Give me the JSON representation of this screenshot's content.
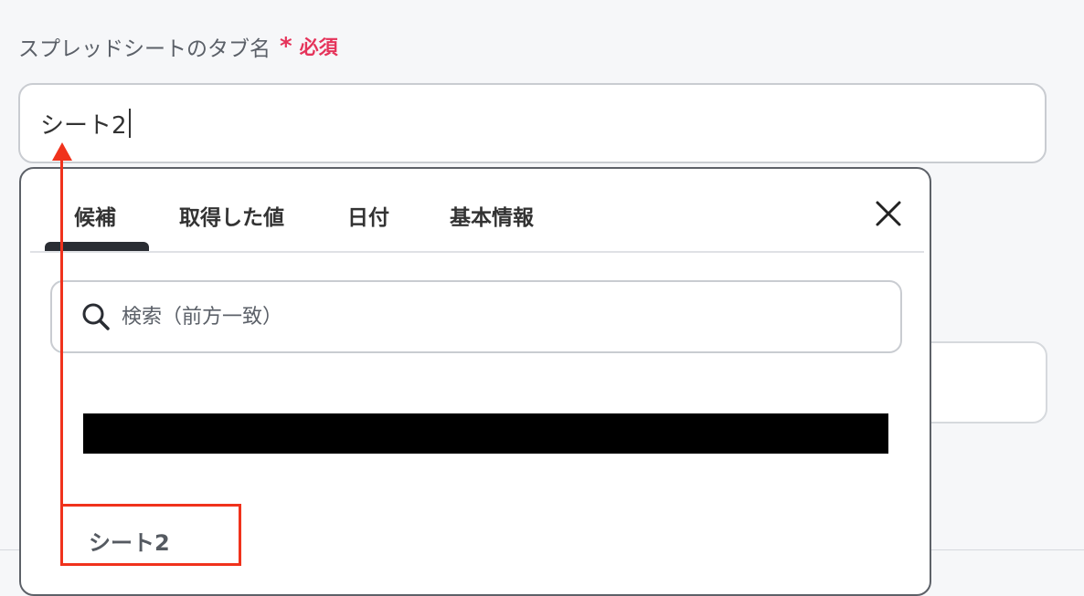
{
  "field": {
    "label": "スプレッドシートのタブ名",
    "required_star": "*",
    "required_text": "必須",
    "value": "シート2"
  },
  "dropdown": {
    "tabs": [
      {
        "label": "候補",
        "active": true
      },
      {
        "label": "取得した値",
        "active": false
      },
      {
        "label": "日付",
        "active": false
      },
      {
        "label": "基本情報",
        "active": false
      }
    ],
    "search_placeholder": "検索（前方一致）",
    "items": [
      {
        "label": "",
        "redacted": true
      },
      {
        "label": "シート2",
        "redacted": false
      }
    ]
  },
  "colors": {
    "required": "#e5335a",
    "annotation": "#f0321c",
    "tab_active_underline": "#2a2d33"
  }
}
